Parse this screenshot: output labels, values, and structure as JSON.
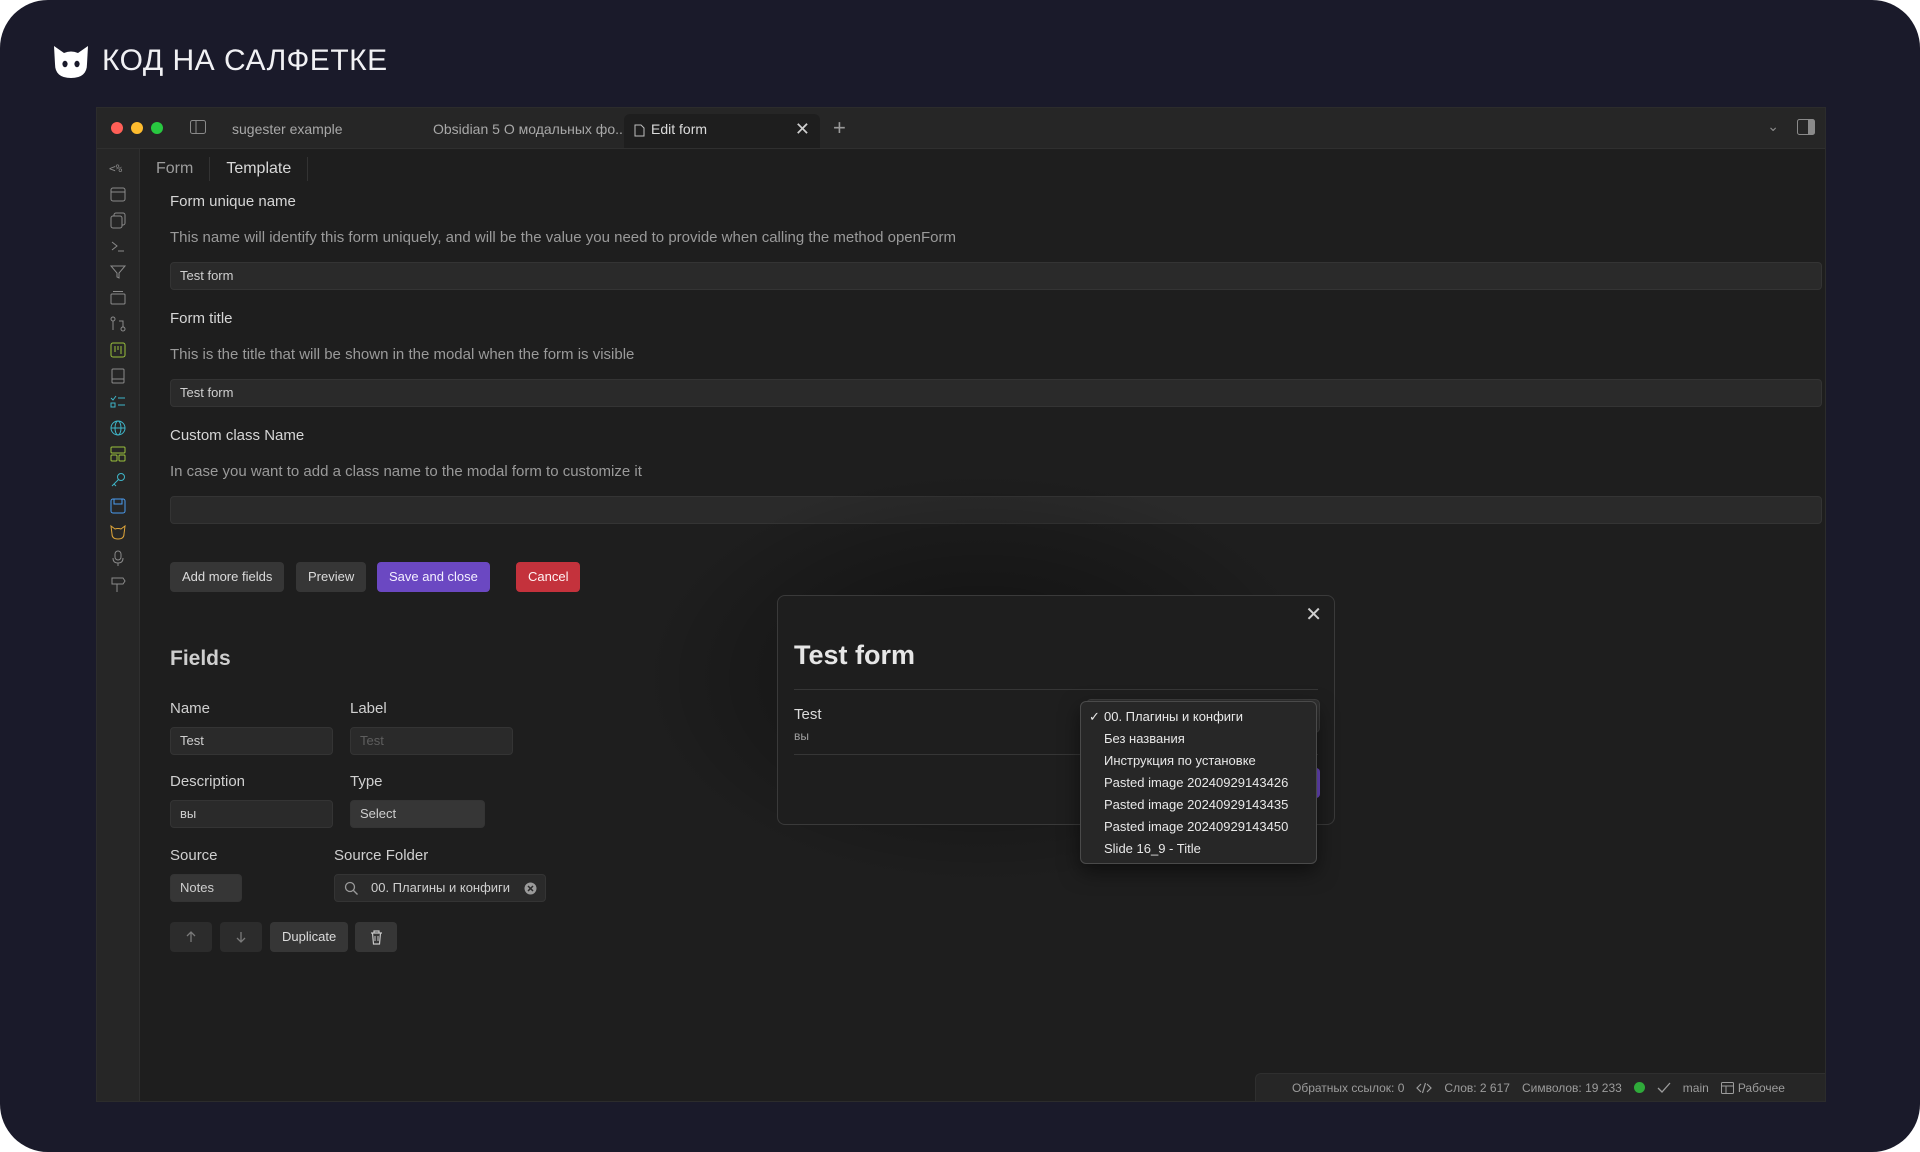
{
  "brand": {
    "name": "КОД НА САЛФЕТКЕ"
  },
  "window": {
    "tabs": [
      {
        "label": "sugester example"
      },
      {
        "label": "Obsidian 5 О модальных фо..."
      },
      {
        "label": "Edit form"
      }
    ],
    "new_tab": "+",
    "tab_close": "✕",
    "chevron": "⌄"
  },
  "editor": {
    "subtabs": [
      "Form",
      "Template"
    ],
    "form_name": {
      "label": "Form unique name",
      "description": "This name will identify this form uniquely, and will be the value you need to provide when calling the method openForm",
      "value": "Test form"
    },
    "form_title": {
      "label": "Form title",
      "description": "This is the title that will be shown in the modal when the form is visible",
      "value": "Test form"
    },
    "custom_class": {
      "label": "Custom class Name",
      "description": "In case you want to add a class name to the modal form to customize it",
      "value": ""
    },
    "buttons": {
      "add_fields": "Add more fields",
      "preview": "Preview",
      "save_close": "Save and close",
      "cancel": "Cancel"
    },
    "fields_heading": "Fields",
    "field": {
      "name_label": "Name",
      "name_value": "Test",
      "label_label": "Label",
      "label_placeholder": "Test",
      "description_label": "Description",
      "description_value": "вы",
      "type_label": "Type",
      "type_value": "Select",
      "source_label": "Source",
      "source_value": "Notes",
      "source_folder_label": "Source Folder",
      "source_folder_value": "00. Плагины и конфиги",
      "duplicate": "Duplicate"
    }
  },
  "status": {
    "backlinks": "Обратных ссылок: 0",
    "words": "Слов: 2 617",
    "chars": "Символов: 19 233",
    "branch": "main",
    "workspace": "Рабочее"
  },
  "modal": {
    "title": "Test form",
    "field_label": "Test",
    "field_desc": "вы",
    "close": "✕"
  },
  "dropdown": {
    "selected_index": 0,
    "check": "✓",
    "options": [
      "00. Плагины и конфиги",
      "Без названия",
      "Инструкция по установке",
      "Pasted image 20240929143426",
      "Pasted image 20240929143435",
      "Pasted image 20240929143450",
      "Slide 16_9 - Title"
    ]
  },
  "colors": {
    "accent": "#6b48c2",
    "danger": "#c4323c",
    "frame_bg": "#1a1a2a",
    "app_bg": "#1e1e1e",
    "sync_ok": "#2faa3a"
  }
}
